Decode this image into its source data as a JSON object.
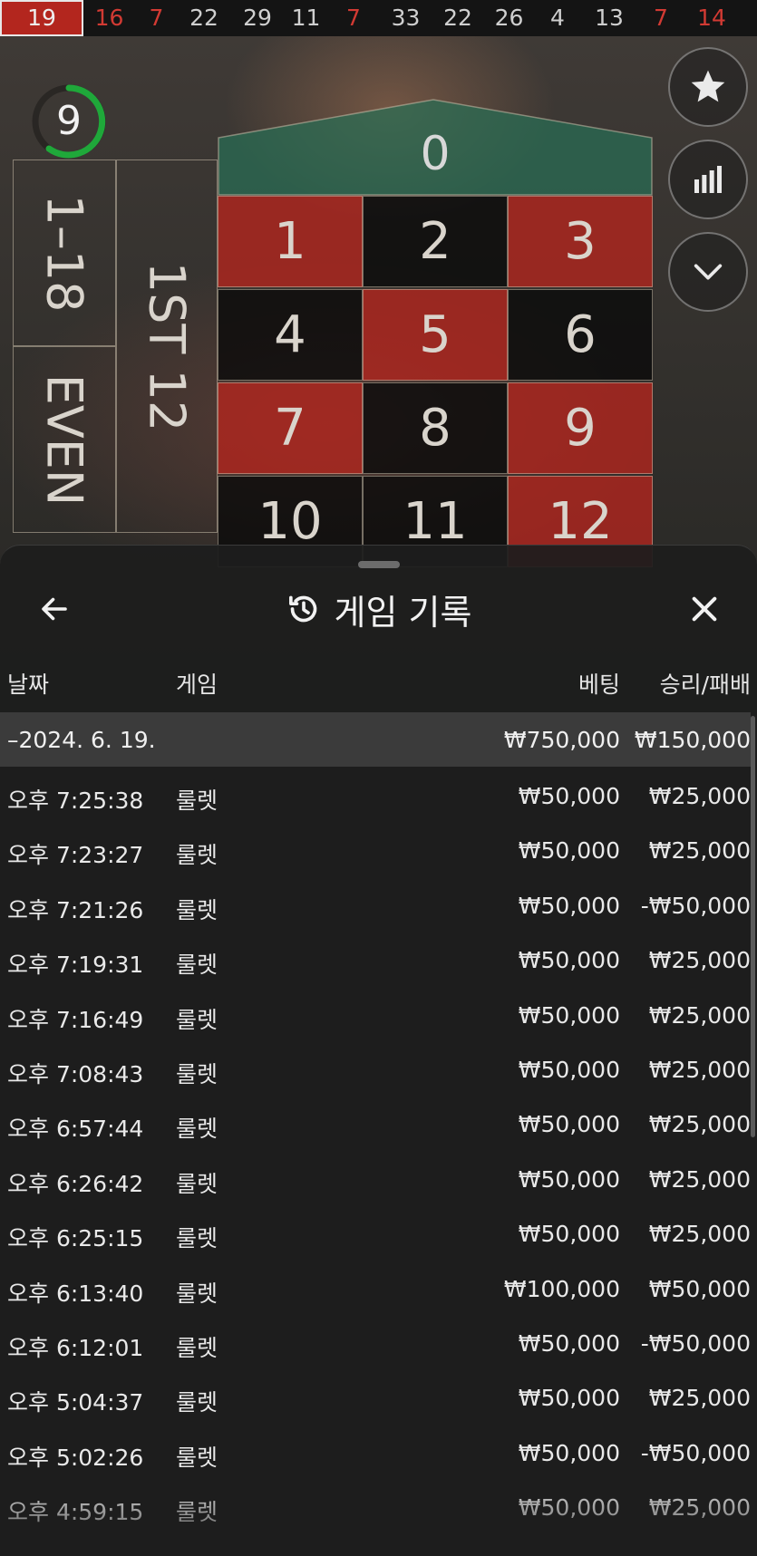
{
  "results_strip": [
    {
      "n": "19",
      "color": "red"
    },
    {
      "n": "16",
      "color": "red"
    },
    {
      "n": "7",
      "color": "red"
    },
    {
      "n": "22",
      "color": "black"
    },
    {
      "n": "29",
      "color": "black"
    },
    {
      "n": "11",
      "color": "black"
    },
    {
      "n": "7",
      "color": "red"
    },
    {
      "n": "33",
      "color": "black"
    },
    {
      "n": "22",
      "color": "black"
    },
    {
      "n": "26",
      "color": "black"
    },
    {
      "n": "4",
      "color": "black"
    },
    {
      "n": "13",
      "color": "black"
    },
    {
      "n": "7",
      "color": "red"
    },
    {
      "n": "14",
      "color": "red"
    }
  ],
  "timer": {
    "value": "9",
    "accent": "#1fa83a"
  },
  "table": {
    "zero": "0",
    "rows": [
      [
        {
          "n": "1",
          "c": "red"
        },
        {
          "n": "2",
          "c": "black"
        },
        {
          "n": "3",
          "c": "red"
        }
      ],
      [
        {
          "n": "4",
          "c": "black"
        },
        {
          "n": "5",
          "c": "red"
        },
        {
          "n": "6",
          "c": "black"
        }
      ],
      [
        {
          "n": "7",
          "c": "red"
        },
        {
          "n": "8",
          "c": "black"
        },
        {
          "n": "9",
          "c": "red"
        }
      ],
      [
        {
          "n": "10",
          "c": "black"
        },
        {
          "n": "11",
          "c": "black"
        },
        {
          "n": "12",
          "c": "red"
        }
      ]
    ],
    "outside_low": "1–18",
    "outside_even": "EVEN",
    "dozen_first": "1ST 12"
  },
  "side_buttons": [
    "star-icon",
    "stats-icon",
    "chevron-down-icon"
  ],
  "history": {
    "title": "게임 기록",
    "columns": {
      "date": "날짜",
      "game": "게임",
      "bet": "베팅",
      "winloss": "승리/패배"
    },
    "day": {
      "date": "–2024. 6. 19.",
      "bet": "₩750,000",
      "winloss": "₩150,000"
    },
    "rows": [
      {
        "time": "오후 7:25:38",
        "game": "룰렛",
        "bet": "₩50,000",
        "winloss": "₩25,000"
      },
      {
        "time": "오후 7:23:27",
        "game": "룰렛",
        "bet": "₩50,000",
        "winloss": "₩25,000"
      },
      {
        "time": "오후 7:21:26",
        "game": "룰렛",
        "bet": "₩50,000",
        "winloss": "-₩50,000"
      },
      {
        "time": "오후 7:19:31",
        "game": "룰렛",
        "bet": "₩50,000",
        "winloss": "₩25,000"
      },
      {
        "time": "오후 7:16:49",
        "game": "룰렛",
        "bet": "₩50,000",
        "winloss": "₩25,000"
      },
      {
        "time": "오후 7:08:43",
        "game": "룰렛",
        "bet": "₩50,000",
        "winloss": "₩25,000"
      },
      {
        "time": "오후 6:57:44",
        "game": "룰렛",
        "bet": "₩50,000",
        "winloss": "₩25,000"
      },
      {
        "time": "오후 6:26:42",
        "game": "룰렛",
        "bet": "₩50,000",
        "winloss": "₩25,000"
      },
      {
        "time": "오후 6:25:15",
        "game": "룰렛",
        "bet": "₩50,000",
        "winloss": "₩25,000"
      },
      {
        "time": "오후 6:13:40",
        "game": "룰렛",
        "bet": "₩100,000",
        "winloss": "₩50,000"
      },
      {
        "time": "오후 6:12:01",
        "game": "룰렛",
        "bet": "₩50,000",
        "winloss": "-₩50,000"
      },
      {
        "time": "오후 5:04:37",
        "game": "룰렛",
        "bet": "₩50,000",
        "winloss": "₩25,000"
      },
      {
        "time": "오후 5:02:26",
        "game": "룰렛",
        "bet": "₩50,000",
        "winloss": "-₩50,000"
      },
      {
        "time": "오후 4:59:15",
        "game": "룰렛",
        "bet": "₩50,000",
        "winloss": "₩25,000"
      }
    ]
  }
}
